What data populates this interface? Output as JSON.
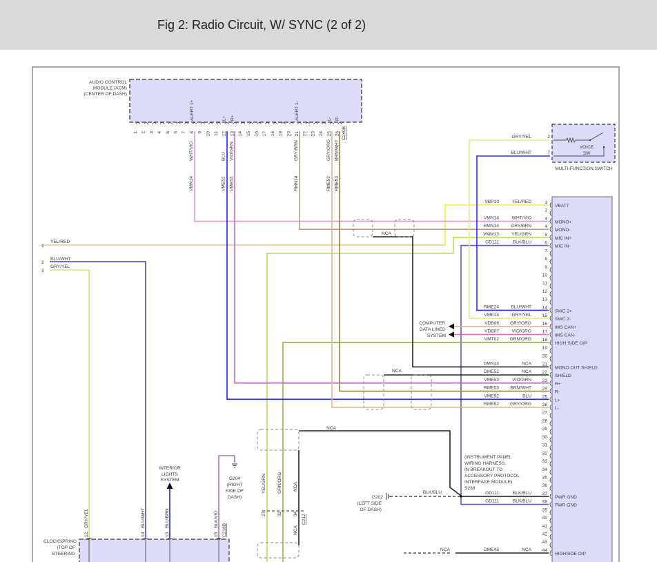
{
  "title": "Fig 2: Radio Circuit, W/ SYNC (2 of 2)",
  "acm": {
    "label": [
      "AUDIO CONTROL",
      "MODULE (ACM)",
      "(CENTER OF DASH)"
    ],
    "connector": "C240B",
    "pin_count": 26,
    "pins": [
      {
        "pin": 8,
        "function": "ALERT 1+",
        "color": "WHT/VIO",
        "circuit": "VMN14"
      },
      {
        "pin": 12,
        "function": "L+",
        "color": "BLU",
        "circuit": "VME52"
      },
      {
        "pin": 13,
        "function": "R+",
        "color": "VIO/GRN",
        "circuit": "VME53"
      },
      {
        "pin": 21,
        "function": "ALERT 1-",
        "color": "GRY/BRN",
        "circuit": "RMN14"
      },
      {
        "pin": 25,
        "function": "L-",
        "color": "GRY/ORG",
        "circuit": "RME52"
      },
      {
        "pin": 26,
        "function": "R-",
        "color": "BRN/WHT",
        "circuit": "RME53"
      }
    ]
  },
  "mfs": {
    "label": "MULTI-FUNCTION SWITCH",
    "switch": [
      "VOICE",
      "SW"
    ],
    "pins": [
      {
        "pin": "2",
        "color": "GRY/YEL"
      },
      {
        "pin": "7",
        "color": "BLU/WHT"
      }
    ]
  },
  "sync_pins": [
    {
      "pin": "1",
      "circuit": "SBP10",
      "color": "YEL/RED",
      "function": "VBATT"
    },
    {
      "pin": "2"
    },
    {
      "pin": "3",
      "circuit": "VMN14",
      "color": "WHT/VIO",
      "function": "MONO+"
    },
    {
      "pin": "4",
      "circuit": "RMN14",
      "color": "GRY/BRN",
      "function": "MONO-"
    },
    {
      "pin": "5",
      "circuit": "VMM13",
      "color": "YEL/GRN",
      "function": "MIC IN+"
    },
    {
      "pin": "6",
      "circuit": "GD111",
      "color": "BLK/BLU",
      "function": "MIC IN-"
    },
    {
      "pin": "7"
    },
    {
      "pin": "8"
    },
    {
      "pin": "9"
    },
    {
      "pin": "10"
    },
    {
      "pin": "11"
    },
    {
      "pin": "12"
    },
    {
      "pin": "13"
    },
    {
      "pin": "14",
      "circuit": "RME24",
      "color": "BLU/WHT",
      "function": "SWC 2+"
    },
    {
      "pin": "15",
      "circuit": "VME14",
      "color": "GRY/YEL",
      "function": "SWC 2-"
    },
    {
      "pin": "16",
      "circuit": "VDB06",
      "color": "GRY/ORG",
      "function": "IMS CAN+"
    },
    {
      "pin": "17",
      "circuit": "VDB07",
      "color": "VIO/ORG",
      "function": "IMS CAN-"
    },
    {
      "pin": "18",
      "circuit": "VMT02",
      "color": "GRN/ORG",
      "function": "HIGH SIDE O/P"
    },
    {
      "pin": "19"
    },
    {
      "pin": "20"
    },
    {
      "pin": "21",
      "circuit": "DMN14",
      "color": "NCA",
      "function": "MONO OUT SHIELD"
    },
    {
      "pin": "22",
      "circuit": "DME52",
      "color": "NCA",
      "function": "SHIELD"
    },
    {
      "pin": "23",
      "circuit": "VME53",
      "color": "VIO/GRN",
      "function": "R+"
    },
    {
      "pin": "24",
      "circuit": "RME53",
      "color": "BRN/WHT",
      "function": "R-"
    },
    {
      "pin": "25",
      "circuit": "VME52",
      "color": "BLU",
      "function": "L+"
    },
    {
      "pin": "26",
      "circuit": "RME52",
      "color": "GRY/ORG",
      "function": "L-"
    },
    {
      "pin": "27"
    },
    {
      "pin": "28"
    },
    {
      "pin": "29"
    },
    {
      "pin": "30"
    },
    {
      "pin": "31"
    },
    {
      "pin": "32"
    },
    {
      "pin": "33"
    },
    {
      "pin": "34"
    },
    {
      "pin": "35"
    },
    {
      "pin": "36"
    },
    {
      "pin": "37",
      "circuit": "GD111",
      "color": "BLK/BLU",
      "function": "PWR GND"
    },
    {
      "pin": "38",
      "circuit": "GD111",
      "color": "BLK/BLU",
      "function": "PWR GND"
    },
    {
      "pin": "39"
    },
    {
      "pin": "40"
    },
    {
      "pin": "41"
    },
    {
      "pin": "42"
    },
    {
      "pin": "43"
    },
    {
      "pin": "44",
      "circuit": "DME45",
      "color": "NCA",
      "function": "HIGHSIDE O/P"
    }
  ],
  "left_harness": [
    {
      "pin": "1",
      "color": "YEL/RED"
    },
    {
      "pin": "2",
      "color": "BLU/WHT"
    },
    {
      "pin": "3",
      "color": "GRY/YEL"
    }
  ],
  "nca": "NCA",
  "computer_data": [
    "COMPUTER",
    "DATA LINES",
    "SYSTEM"
  ],
  "c212": {
    "connector": "C212",
    "pins": [
      {
        "pin": "27",
        "color": "YEL/GRN"
      },
      {
        "pin": "32",
        "color": "GRN/ORG"
      },
      {
        "pin": "34",
        "color": "NCA"
      }
    ]
  },
  "g202": {
    "label": [
      "G202",
      "(LEFT SIDE",
      "OF DASH)"
    ],
    "wire_color": "BLK/BLU"
  },
  "s238": {
    "desc": [
      "(INSTRUMENT PANEL",
      "WIRING HARNESS,",
      "IN BREAKOUT TO",
      "ACCESSORY PROTOCOL",
      "INTERFACE MODULE)"
    ],
    "id": "S238"
  },
  "g204": [
    "G204",
    "(RIGHT",
    "SIDE OF",
    "DASH)"
  ],
  "interior": [
    "INTERIOR",
    "LIGHTS",
    "SYSTEM"
  ],
  "clockspring": {
    "label": [
      "CLOCKSPRING",
      "(TOP OF",
      "STEERING"
    ],
    "connector": "C218B",
    "pins": [
      {
        "pin": "12",
        "color": "GRY/YEL"
      },
      {
        "pin": "14",
        "color": "BLU/WHT"
      },
      {
        "pin": "13",
        "color": "BLU/BRN"
      },
      {
        "pin": "15",
        "color": "BLK/VIO"
      }
    ]
  }
}
